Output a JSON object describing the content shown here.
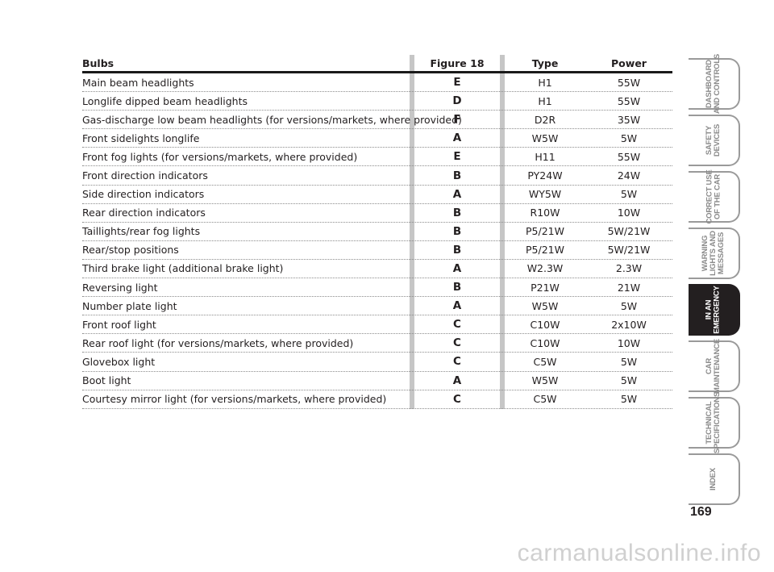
{
  "table": {
    "headers": {
      "bulbs": "Bulbs",
      "figure": "Figure 18",
      "type": "Type",
      "power": "Power"
    },
    "rows": [
      {
        "name": "Main beam headlights",
        "figure": "E",
        "type": "H1",
        "power": "55W"
      },
      {
        "name": "Longlife dipped beam headlights",
        "figure": "D",
        "type": "H1",
        "power": "55W"
      },
      {
        "name": "Gas-discharge low beam headlights (for versions/markets, where provided)",
        "figure": "F",
        "type": "D2R",
        "power": "35W"
      },
      {
        "name": "Front sidelights longlife",
        "figure": "A",
        "type": "W5W",
        "power": "5W"
      },
      {
        "name": "Front fog lights (for versions/markets, where provided)",
        "figure": "E",
        "type": "H11",
        "power": "55W"
      },
      {
        "name": "Front direction indicators",
        "figure": "B",
        "type": "PY24W",
        "power": "24W"
      },
      {
        "name": "Side direction indicators",
        "figure": "A",
        "type": "WY5W",
        "power": "5W"
      },
      {
        "name": "Rear direction indicators",
        "figure": "B",
        "type": "R10W",
        "power": "10W"
      },
      {
        "name": "Taillights/rear fog lights",
        "figure": "B",
        "type": "P5/21W",
        "power": "5W/21W"
      },
      {
        "name": "Rear/stop positions",
        "figure": "B",
        "type": "P5/21W",
        "power": "5W/21W"
      },
      {
        "name": "Third brake light (additional brake light)",
        "figure": "A",
        "type": "W2.3W",
        "power": "2.3W"
      },
      {
        "name": "Reversing light",
        "figure": "B",
        "type": "P21W",
        "power": "21W"
      },
      {
        "name": "Number plate light",
        "figure": "A",
        "type": "W5W",
        "power": "5W"
      },
      {
        "name": "Front roof light",
        "figure": "C",
        "type": "C10W",
        "power": "2x10W"
      },
      {
        "name": "Rear roof light (for versions/markets, where provided)",
        "figure": "C",
        "type": "C10W",
        "power": "10W"
      },
      {
        "name": "Glovebox light",
        "figure": "C",
        "type": "C5W",
        "power": "5W"
      },
      {
        "name": "Boot light",
        "figure": "A",
        "type": "W5W",
        "power": "5W"
      },
      {
        "name": "Courtesy mirror light (for versions/markets, where provided)",
        "figure": "C",
        "type": "C5W",
        "power": "5W"
      }
    ]
  },
  "side_nav": {
    "tabs": [
      {
        "label": "DASHBOARD\nAND CONTROLS",
        "active": false
      },
      {
        "label": "SAFETY\nDEVICES",
        "active": false
      },
      {
        "label": "CORRECT USE\nOF THE CAR",
        "active": false
      },
      {
        "label": "WARNING\nLIGHTS AND\nMESSAGES",
        "active": false
      },
      {
        "label": "IN AN\nEMERGENCY",
        "active": true
      },
      {
        "label": "CAR\nMAINTENANCE",
        "active": false
      },
      {
        "label": "TECHNICAL\nSPECIFICATIONS",
        "active": false
      },
      {
        "label": "INDEX",
        "active": false
      }
    ]
  },
  "page_number": "169",
  "watermark": "carmanualsonline.info",
  "colors": {
    "text": "#231f20",
    "column_band": "#c6c6c6",
    "tab_border": "#9a9a9a",
    "active_tab": "#231f20"
  }
}
